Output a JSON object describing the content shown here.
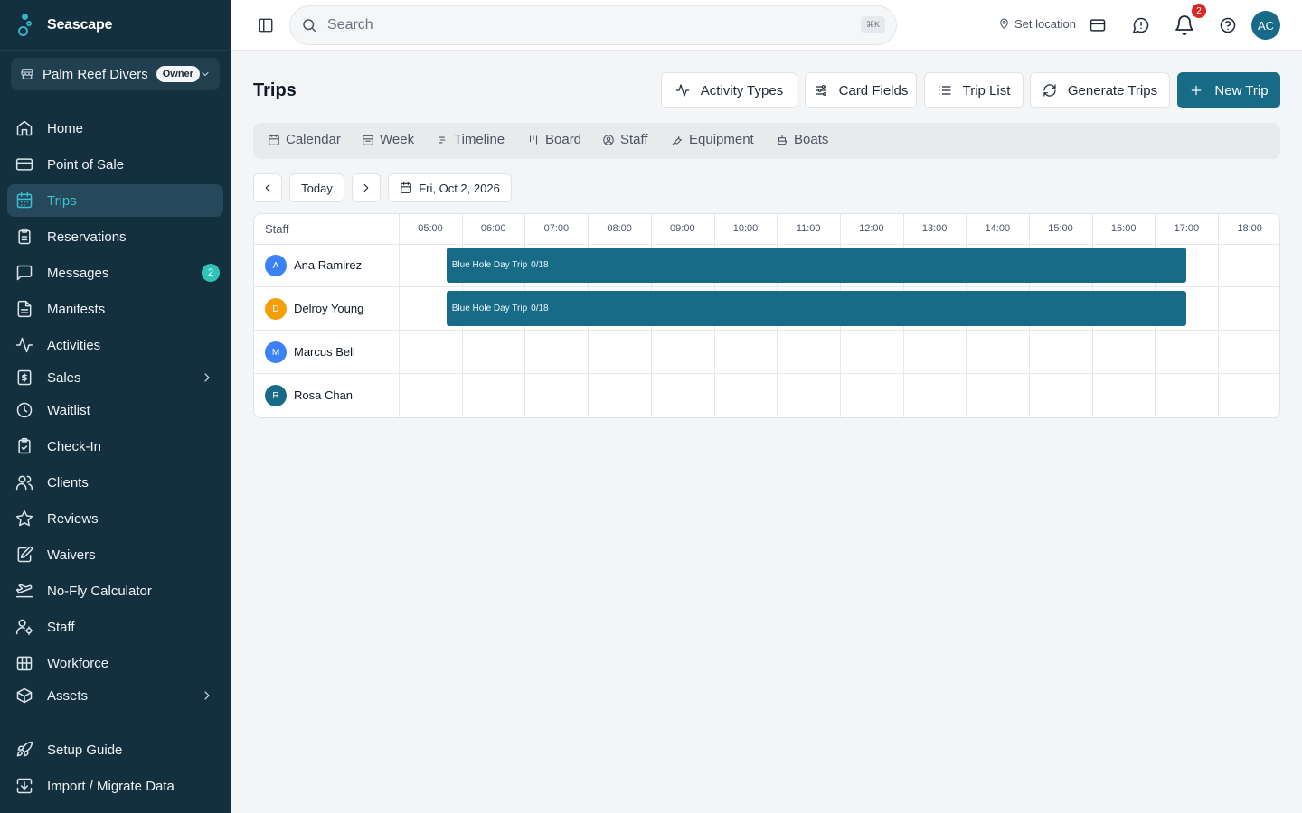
{
  "app": {
    "brand": "Seascape",
    "org_name": "Palm Reef Divers",
    "org_role": "Owner"
  },
  "sidebar": {
    "items": [
      {
        "label": "Home",
        "icon": "home-icon"
      },
      {
        "label": "Point of Sale",
        "icon": "credit-card-icon"
      },
      {
        "label": "Trips",
        "icon": "calendar-icon",
        "active": true
      },
      {
        "label": "Reservations",
        "icon": "clipboard-icon"
      },
      {
        "label": "Messages",
        "icon": "message-icon",
        "badge": "2"
      },
      {
        "label": "Manifests",
        "icon": "document-icon"
      },
      {
        "label": "Activities",
        "icon": "activity-icon"
      },
      {
        "label": "Sales",
        "icon": "receipt-icon",
        "expandable": true
      },
      {
        "label": "Waitlist",
        "icon": "clock-icon"
      },
      {
        "label": "Check-In",
        "icon": "clipboard-check-icon"
      },
      {
        "label": "Clients",
        "icon": "users-icon"
      },
      {
        "label": "Reviews",
        "icon": "star-icon"
      },
      {
        "label": "Waivers",
        "icon": "signature-icon"
      },
      {
        "label": "No-Fly Calculator",
        "icon": "plane-icon"
      },
      {
        "label": "Staff",
        "icon": "user-cog-icon"
      },
      {
        "label": "Workforce",
        "icon": "building-icon"
      },
      {
        "label": "Assets",
        "icon": "box-icon",
        "expandable": true
      },
      {
        "label": "Setup Guide",
        "icon": "rocket-icon"
      },
      {
        "label": "Import / Migrate Data",
        "icon": "import-icon"
      }
    ]
  },
  "topbar": {
    "search_placeholder": "Search",
    "search_shortcut": "⌘K",
    "set_location": "Set location",
    "notifications_count": "2",
    "user_initials": "AC"
  },
  "page": {
    "title": "Trips",
    "actions": {
      "activity_types": "Activity Types",
      "card_fields": "Card Fields",
      "trip_list": "Trip List",
      "generate_trips": "Generate Trips",
      "new_trip": "New Trip"
    },
    "view_tabs": [
      "Calendar",
      "Week",
      "Timeline",
      "Board",
      "Staff",
      "Equipment",
      "Boats"
    ],
    "date_nav": {
      "today": "Today",
      "date": "Fri, Oct 2, 2026"
    }
  },
  "timeline": {
    "staff_header": "Staff",
    "hours": [
      "05:00",
      "06:00",
      "07:00",
      "08:00",
      "09:00",
      "10:00",
      "11:00",
      "12:00",
      "13:00",
      "14:00",
      "15:00",
      "16:00",
      "17:00",
      "18:00"
    ],
    "rows": [
      {
        "initial": "A",
        "name": "Ana Ramirez",
        "color": "#3b82f6",
        "trip": {
          "title": "Blue Hole Day Trip",
          "count": "0/18"
        }
      },
      {
        "initial": "D",
        "name": "Delroy Young",
        "color": "#f59e0b",
        "trip": {
          "title": "Blue Hole Day Trip",
          "count": "0/18"
        }
      },
      {
        "initial": "M",
        "name": "Marcus Bell",
        "color": "#3b82f6"
      },
      {
        "initial": "R",
        "name": "Rosa Chan",
        "color": "#176b87"
      }
    ]
  },
  "colors": {
    "sidebar_bg": "#14303f",
    "accent": "#176b87",
    "active_nav": "#3ac0d2",
    "badge": "#2ec4b6",
    "notification": "#dc2626"
  }
}
